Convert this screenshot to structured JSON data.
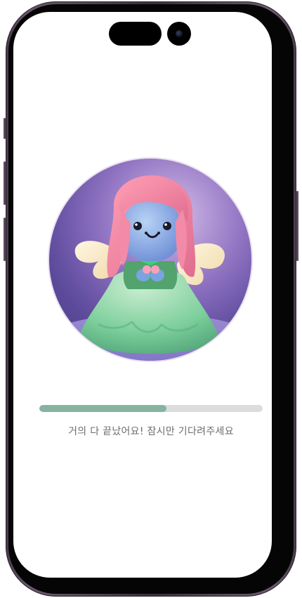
{
  "loading": {
    "progress": 0.57,
    "message": "거의 다 끝났어요! 잠시만 기다려주세요"
  },
  "avatar": {
    "icon": "angel-character-image"
  },
  "colors": {
    "progress_fill": "#86b3a0",
    "progress_track": "#dcdcdc",
    "text": "#6d6d6d"
  }
}
